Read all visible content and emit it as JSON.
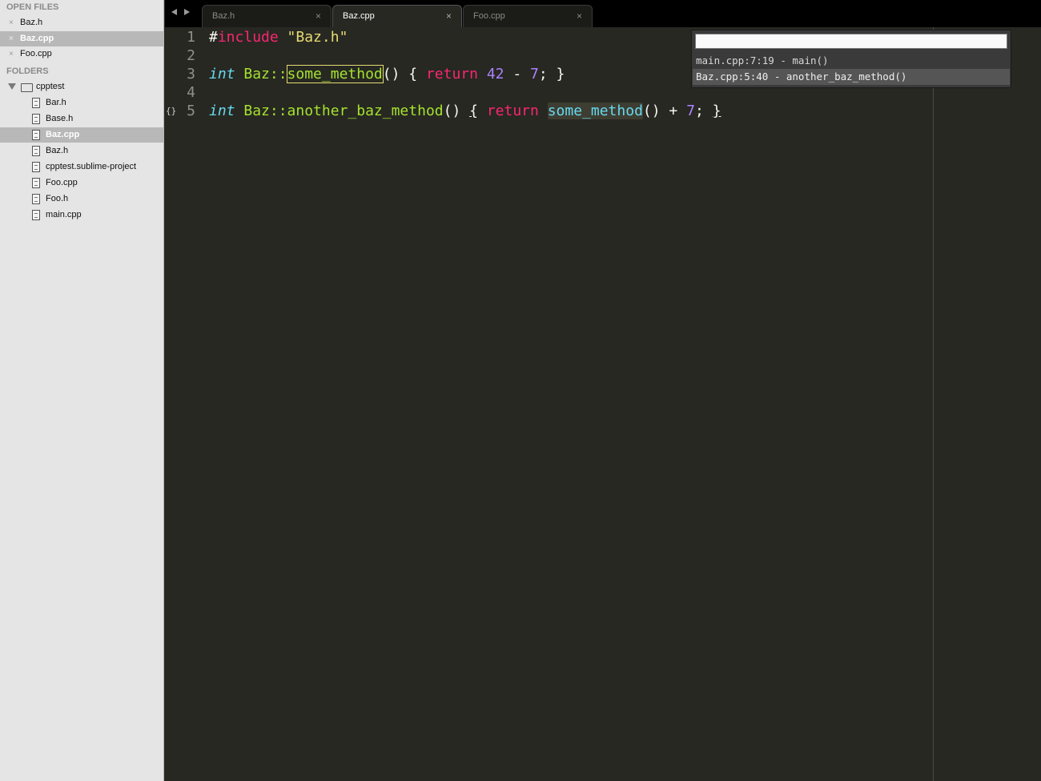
{
  "sidebar": {
    "open_files_header": "OPEN FILES",
    "open_files": [
      {
        "close": "×",
        "label": "Baz.h"
      },
      {
        "close": "×",
        "label": "Baz.cpp"
      },
      {
        "close": "×",
        "label": "Foo.cpp"
      }
    ],
    "folders_header": "FOLDERS",
    "folder": {
      "label": "cpptest"
    },
    "files": [
      {
        "label": "Bar.h"
      },
      {
        "label": "Base.h"
      },
      {
        "label": "Baz.cpp"
      },
      {
        "label": "Baz.h"
      },
      {
        "label": "cpptest.sublime-project"
      },
      {
        "label": "Foo.cpp"
      },
      {
        "label": "Foo.h"
      },
      {
        "label": "main.cpp"
      }
    ]
  },
  "tabs": [
    {
      "label": "Baz.h",
      "close": "×"
    },
    {
      "label": "Baz.cpp",
      "close": "×"
    },
    {
      "label": "Foo.cpp",
      "close": "×"
    }
  ],
  "editor": {
    "line_numbers": [
      "1",
      "2",
      "3",
      "4",
      "5"
    ],
    "gutter_marker": "{}",
    "line1": {
      "hash": "#",
      "include": "include",
      "space": " ",
      "header": "\"Baz.h\""
    },
    "line3": {
      "type": "int",
      "sp1": " ",
      "cls": "Baz::",
      "method": "some_method",
      "paren": "() { ",
      "ret": "return",
      "sp2": " ",
      "n1": "42",
      "minus": " - ",
      "n2": "7",
      "end": "; }"
    },
    "line5": {
      "type": "int",
      "sp1": " ",
      "cls": "Baz::",
      "method": "another_baz_method",
      "paren": "() ",
      "lbrace": "{",
      "sp2": " ",
      "ret": "return",
      "sp3": " ",
      "call": "some_method",
      "call_paren": "() + ",
      "n": "7",
      "semi": "; ",
      "rbrace": "}"
    }
  },
  "quick_panel": {
    "input_value": "",
    "items": [
      {
        "label": "main.cpp:7:19 - main()"
      },
      {
        "label": "Baz.cpp:5:40 - another_baz_method()"
      }
    ]
  },
  "colors": {
    "background": "#272822",
    "keyword": "#f92672",
    "type": "#66d9ef",
    "function": "#a6e22e",
    "string": "#e6db74",
    "number": "#ae81ff",
    "sidebar": "#e5e5e5"
  }
}
